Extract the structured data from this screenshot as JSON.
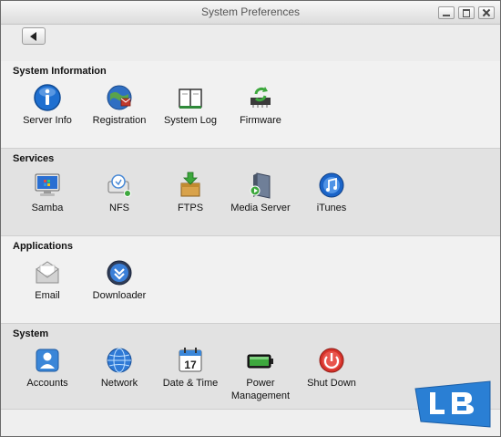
{
  "window": {
    "title": "System Preferences"
  },
  "sections": [
    {
      "title": "System Information",
      "items": [
        {
          "label": "Server Info",
          "icon": "info-icon"
        },
        {
          "label": "Registration",
          "icon": "registration-globe-icon"
        },
        {
          "label": "System Log",
          "icon": "book-icon"
        },
        {
          "label": "Firmware",
          "icon": "firmware-chip-icon"
        }
      ]
    },
    {
      "title": "Services",
      "items": [
        {
          "label": "Samba",
          "icon": "monitor-icon"
        },
        {
          "label": "NFS",
          "icon": "nfs-drive-icon"
        },
        {
          "label": "FTPS",
          "icon": "ftps-box-icon"
        },
        {
          "label": "Media Server",
          "icon": "media-server-icon"
        },
        {
          "label": "iTunes",
          "icon": "itunes-icon"
        }
      ]
    },
    {
      "title": "Applications",
      "items": [
        {
          "label": "Email",
          "icon": "envelope-icon"
        },
        {
          "label": "Downloader",
          "icon": "download-icon"
        }
      ]
    },
    {
      "title": "System",
      "items": [
        {
          "label": "Accounts",
          "icon": "user-icon"
        },
        {
          "label": "Network",
          "icon": "network-globe-icon"
        },
        {
          "label": "Date & Time",
          "icon": "calendar-icon"
        },
        {
          "label": "Power Management",
          "icon": "battery-icon"
        },
        {
          "label": "Shut Down",
          "icon": "power-icon"
        }
      ]
    }
  ],
  "calendar_day": "17",
  "colors": {
    "info_blue": "#1e6fd0",
    "ok_green": "#3da83d",
    "power_red": "#d6322a",
    "logo_blue": "#2a7fd4"
  }
}
